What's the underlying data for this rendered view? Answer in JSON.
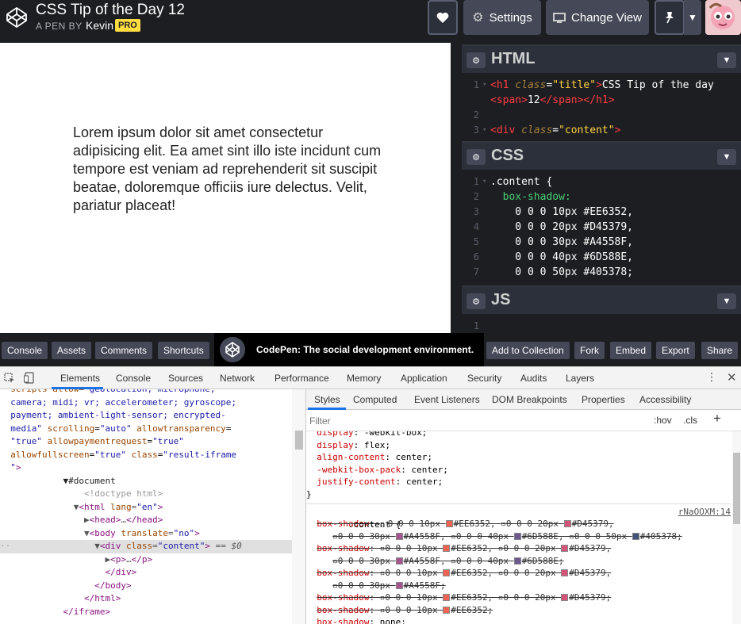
{
  "header": {
    "title": "CSS Tip of the Day 12",
    "by_label": "A PEN BY",
    "author": "Kevin",
    "badge": "PRO",
    "settings_label": "Settings",
    "change_view_label": "Change View"
  },
  "preview": {
    "text": "Lorem ipsum dolor sit amet consectetur adipisicing elit. Ea amet sint illo iste incidunt cum tempore est veniam ad reprehenderit sit suscipit beatae, doloremque officiis iure delectus. Velit, pariatur placeat!"
  },
  "editors": {
    "html": {
      "title": "HTML",
      "lines": [
        {
          "num": "1",
          "fold": "▾"
        },
        {
          "num": "",
          "fold": ""
        },
        {
          "num": "2",
          "fold": ""
        },
        {
          "num": "3",
          "fold": "▾"
        }
      ]
    },
    "css": {
      "title": "CSS",
      "lines": [
        {
          "num": "1",
          "fold": "▾",
          "text": ".content {"
        },
        {
          "num": "2",
          "fold": "",
          "text": "  box-shadow:"
        },
        {
          "num": "3",
          "fold": "",
          "text": "    0 0 0 10px #EE6352,"
        },
        {
          "num": "4",
          "fold": "",
          "text": "    0 0 0 20px #D45379,"
        },
        {
          "num": "5",
          "fold": "",
          "text": "    0 0 0 30px #A4558F,"
        },
        {
          "num": "6",
          "fold": "",
          "text": "    0 0 0 40px #6D588E,"
        },
        {
          "num": "7",
          "fold": "",
          "text": "    0 0 0 50px #405378;"
        }
      ]
    },
    "js": {
      "title": "JS",
      "line_num": "1"
    }
  },
  "bottombar": {
    "console": "Console",
    "assets": "Assets",
    "comments": "Comments",
    "shortcuts": "Shortcuts",
    "promo": "CodePen: The social development environment.",
    "add_to_collection": "Add to Collection",
    "fork": "Fork",
    "embed": "Embed",
    "export": "Export",
    "share": "Share"
  },
  "devtools": {
    "tabs": [
      "Elements",
      "Console",
      "Sources",
      "Network",
      "Performance",
      "Memory",
      "Application",
      "Security",
      "Audits",
      "Layers"
    ],
    "styles_tabs": [
      "Styles",
      "Computed",
      "Event Listeners",
      "DOM Breakpoints",
      "Properties",
      "Accessibility"
    ],
    "filter_placeholder": "Filter",
    "hov": ":hov",
    "cls": ".cls",
    "rule_source": "rNaOOXM:14",
    "rule_selector": ".content {"
  },
  "colors": {
    "c1": "#EE6352",
    "c2": "#D45379",
    "c3": "#A4558F",
    "c4": "#6D588E",
    "c5": "#405378"
  }
}
